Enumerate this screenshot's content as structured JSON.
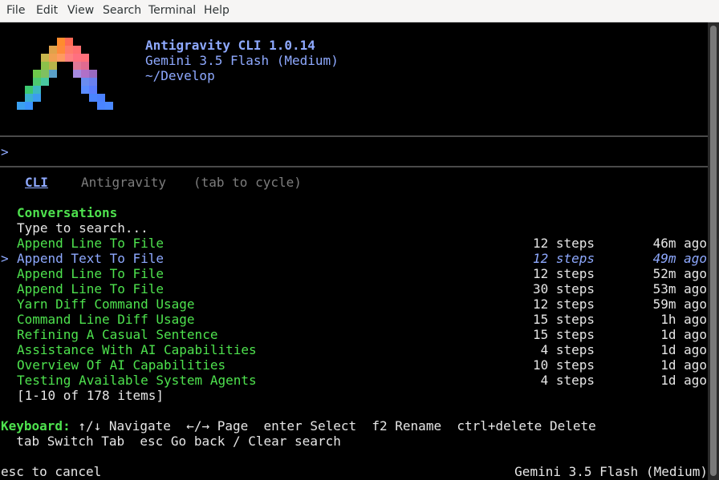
{
  "menu": [
    "File",
    "Edit",
    "View",
    "Search",
    "Terminal",
    "Help"
  ],
  "header": {
    "title": "Antigravity CLI 1.0.14",
    "model": "Gemini 3.5 Flash (Medium)",
    "cwd": "~/Develop"
  },
  "prompt": {
    "marker": ">"
  },
  "tabs": {
    "active": "CLI",
    "inactive": "Antigravity",
    "hint": "(tab to cycle)"
  },
  "conversations": {
    "title": "Conversations",
    "search_placeholder": "Type to search...",
    "selected_marker": ">",
    "rows": [
      {
        "title": "Append Line To File",
        "steps": "12 steps",
        "age": "46m ago"
      },
      {
        "title": "Append Text To File",
        "steps": "12 steps",
        "age": "49m ago"
      },
      {
        "title": "Append Line To File",
        "steps": "12 steps",
        "age": "52m ago"
      },
      {
        "title": "Append Line To File",
        "steps": "30 steps",
        "age": "53m ago"
      },
      {
        "title": "Yarn Diff Command Usage",
        "steps": "12 steps",
        "age": "59m ago"
      },
      {
        "title": "Command Line Diff Usage",
        "steps": "15 steps",
        "age": "1h ago"
      },
      {
        "title": "Refining A Casual Sentence",
        "steps": "15 steps",
        "age": "1d ago"
      },
      {
        "title": "Assistance With AI Capabilities",
        "steps": "4 steps",
        "age": "1d ago"
      },
      {
        "title": "Overview Of AI Capabilities",
        "steps": "10 steps",
        "age": "1d ago"
      },
      {
        "title": "Testing Available System Agents",
        "steps": "4 steps",
        "age": "1d ago"
      }
    ],
    "pagination": "[1-10 of 178 items]"
  },
  "keyboard": {
    "label": "Keyboard:",
    "line1": " ↑/↓ Navigate  ←/→ Page  enter Select  f2 Rename  ctrl+delete Delete",
    "line2": "  tab Switch Tab  esc Go back / Clear search"
  },
  "footer": {
    "left": "esc to cancel",
    "right": "Gemini 3.5 Flash (Medium)"
  },
  "colors": {
    "accent_green": "#4ee24e",
    "accent_blue": "#8ea9ff",
    "muted": "#7d7d7d"
  }
}
